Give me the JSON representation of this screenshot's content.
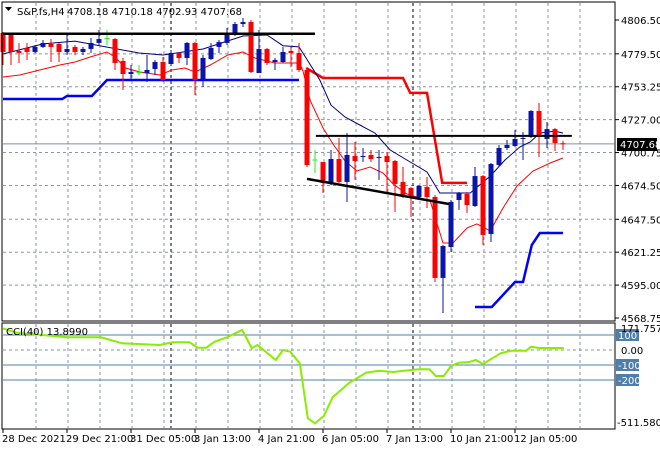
{
  "header": {
    "symbol": "S&P.fs,H4",
    "ohlc": "4708.18 4710.18 4702.93 4707.68"
  },
  "price_axis": {
    "ticks": [
      "4806.50",
      "4779.50",
      "4753.25",
      "4727.00",
      "4700.75",
      "4674.50",
      "4647.50",
      "4621.25",
      "4595.00",
      "4568.75"
    ],
    "tick_values": [
      4806.5,
      4779.5,
      4753.25,
      4727.0,
      4700.75,
      4674.5,
      4647.5,
      4621.25,
      4595.0,
      4568.75
    ],
    "current_price_label": "4707.68",
    "current_price": 4707.68
  },
  "time_axis": {
    "labels": [
      "28 Dec 2021",
      "29 Dec 21:00",
      "31 Dec 05:00",
      "3 Jan 13:00",
      "4 Jan 21:00",
      "6 Jan 05:00",
      "7 Jan 13:00",
      "10 Jan 21:00",
      "12 Jan 05:00"
    ],
    "label_candle_index": [
      0,
      8,
      16,
      24,
      32,
      40,
      48,
      56,
      64
    ]
  },
  "indicator": {
    "label": "CCI(40) 13.8990",
    "max_label": "171.757",
    "min_label": "-511.5801",
    "levels": [
      "100",
      "0.00",
      "-100",
      "-200"
    ],
    "level_values": [
      100,
      0,
      -100,
      -200
    ],
    "range": [
      -511.5801,
      171.757
    ]
  },
  "colors": {
    "bull": "#0a14a8",
    "bear": "#ff0000",
    "doji": "#22ee22",
    "ma_navy": "#000080",
    "ma_red": "#ff0000",
    "channel_blue": "#0000ff",
    "cci": "#88ee00",
    "level": "#4f7fa8"
  },
  "chart_data": {
    "type": "candlestick",
    "title": "S&P.fs,H4",
    "ylim": [
      4568.75,
      4806.5
    ],
    "candles": [
      [
        4796.1,
        4796.9,
        4770.6,
        4781.0
      ],
      [
        4794.5,
        4795.3,
        4770.6,
        4781.0
      ],
      [
        4781.8,
        4788.2,
        4772.2,
        4780.2
      ],
      [
        4784.2,
        4788.2,
        4774.6,
        4781.0
      ],
      [
        4781.0,
        4786.6,
        4780.2,
        4785.0
      ],
      [
        4785.0,
        4790.5,
        4784.2,
        4788.2
      ],
      [
        4787.4,
        4791.3,
        4773.0,
        4785.0
      ],
      [
        4787.4,
        4788.2,
        4773.0,
        4781.0
      ],
      [
        4781.0,
        4796.1,
        4778.6,
        4783.4
      ],
      [
        4785.0,
        4786.6,
        4778.6,
        4781.0
      ],
      [
        4781.0,
        4785.0,
        4778.6,
        4783.4
      ],
      [
        4783.4,
        4792.1,
        4780.2,
        4788.2
      ],
      [
        4788.2,
        4798.5,
        4786.6,
        4791.3
      ],
      [
        4792.1,
        4798.5,
        4786.6,
        4792.1
      ],
      [
        4791.3,
        4792.1,
        4766.6,
        4772.2
      ],
      [
        4773.8,
        4776.2,
        4750.7,
        4763.4
      ],
      [
        4763.4,
        4770.6,
        4758.6,
        4765.0
      ],
      [
        4765.0,
        4770.6,
        4762.6,
        4765.0
      ],
      [
        4764.2,
        4778.6,
        4757.0,
        4766.6
      ],
      [
        4767.4,
        4774.6,
        4762.6,
        4773.0
      ],
      [
        4773.0,
        4777.0,
        4757.0,
        4758.6
      ],
      [
        4771.4,
        4782.6,
        4770.6,
        4780.2
      ],
      [
        4780.2,
        4781.0,
        4772.2,
        4776.2
      ],
      [
        4776.2,
        4788.9,
        4770.6,
        4788.2
      ],
      [
        4788.2,
        4788.9,
        4746.7,
        4758.6
      ],
      [
        4758.6,
        4778.6,
        4753.0,
        4776.2
      ],
      [
        4775.4,
        4788.2,
        4774.6,
        4784.2
      ],
      [
        4785.0,
        4790.5,
        4780.2,
        4788.9
      ],
      [
        4788.2,
        4800.1,
        4786.6,
        4796.1
      ],
      [
        4796.1,
        4804.9,
        4793.7,
        4803.3
      ],
      [
        4803.3,
        4808.1,
        4800.9,
        4804.9
      ],
      [
        4804.9,
        4806.5,
        4764.2,
        4765.0
      ],
      [
        4764.2,
        4798.5,
        4764.2,
        4783.4
      ],
      [
        4783.4,
        4784.2,
        4770.6,
        4772.2
      ],
      [
        4773.0,
        4776.2,
        4766.6,
        4774.6
      ],
      [
        4773.0,
        4785.0,
        4772.2,
        4781.0
      ],
      [
        4781.8,
        4785.0,
        4769.0,
        4780.2
      ],
      [
        4780.2,
        4788.2,
        4765.0,
        4766.6
      ],
      [
        4766.6,
        4768.2,
        4689.2,
        4690.8
      ],
      [
        4694.8,
        4702.8,
        4684.4,
        4695.2
      ],
      [
        4693.2,
        4693.2,
        4668.5,
        4676.5
      ],
      [
        4676.5,
        4702.8,
        4674.9,
        4695.6
      ],
      [
        4695.6,
        4712.4,
        4676.5,
        4677.3
      ],
      [
        4677.3,
        4716.3,
        4661.3,
        4698.8
      ],
      [
        4698.0,
        4709.2,
        4678.9,
        4694.0
      ],
      [
        4697.2,
        4704.4,
        4693.2,
        4698.0
      ],
      [
        4698.8,
        4702.8,
        4693.2,
        4695.6
      ],
      [
        4696.4,
        4702.8,
        4678.9,
        4697.2
      ],
      [
        4698.0,
        4701.2,
        4669.3,
        4693.2
      ],
      [
        4694.0,
        4694.8,
        4653.3,
        4675.7
      ],
      [
        4677.3,
        4689.2,
        4664.5,
        4665.3
      ],
      [
        4672.5,
        4673.3,
        4649.3,
        4665.3
      ],
      [
        4665.3,
        4674.9,
        4664.5,
        4674.1
      ],
      [
        4673.3,
        4681.2,
        4656.5,
        4665.3
      ],
      [
        4665.3,
        4666.9,
        4597.5,
        4600.7
      ],
      [
        4600.7,
        4627.0,
        4572.7,
        4626.2
      ],
      [
        4625.4,
        4662.9,
        4621.4,
        4661.3
      ],
      [
        4662.9,
        4669.3,
        4655.0,
        4668.5
      ],
      [
        4667.7,
        4669.3,
        4652.5,
        4658.9
      ],
      [
        4658.1,
        4689.2,
        4657.3,
        4682.0
      ],
      [
        4682.0,
        4682.8,
        4627.0,
        4635.0
      ],
      [
        4635.8,
        4692.4,
        4629.4,
        4691.6
      ],
      [
        4690.8,
        4706.8,
        4689.2,
        4704.4
      ],
      [
        4704.4,
        4710.8,
        4702.8,
        4706.8
      ],
      [
        4706.0,
        4718.7,
        4705.2,
        4711.6
      ],
      [
        4711.6,
        4717.1,
        4694.8,
        4712.4
      ],
      [
        4713.2,
        4734.7,
        4712.4,
        4733.9
      ],
      [
        4733.9,
        4740.3,
        4697.2,
        4713.2
      ],
      [
        4711.6,
        4725.1,
        4704.4,
        4719.5
      ],
      [
        4719.5,
        4720.3,
        4702.0,
        4708.4
      ],
      [
        4708.18,
        4710.18,
        4702.93,
        4707.68
      ]
    ],
    "lines": {
      "ma_navy": [
        [
          0,
          4779.4
        ],
        [
          5,
          4787.4
        ],
        [
          9,
          4789.7
        ],
        [
          17,
          4780.2
        ],
        [
          20,
          4778.6
        ],
        [
          25,
          4783.4
        ],
        [
          30,
          4793.7
        ],
        [
          33,
          4794.5
        ],
        [
          35,
          4786.0
        ],
        [
          37,
          4785.0
        ],
        [
          38,
          4775.0
        ],
        [
          39.6,
          4758.6
        ],
        [
          41,
          4738.6
        ],
        [
          42.75,
          4729.1
        ],
        [
          44.6,
          4722.7
        ],
        [
          46.5,
          4716.3
        ],
        [
          48.4,
          4702.8
        ],
        [
          50.9,
          4693.2
        ],
        [
          53,
          4685.2
        ],
        [
          54.6,
          4668.5
        ],
        [
          58.4,
          4668.5
        ],
        [
          59.6,
          4674.9
        ],
        [
          60.9,
          4682.0
        ],
        [
          62.75,
          4694.8
        ],
        [
          64.6,
          4705.2
        ],
        [
          65.9,
          4709.2
        ],
        [
          67.1,
          4716.3
        ],
        [
          69,
          4717.9
        ],
        [
          70,
          4716.3
        ]
      ],
      "ma_red": [
        [
          0,
          4761.0
        ],
        [
          2.1,
          4762.6
        ],
        [
          4.6,
          4766.6
        ],
        [
          7.1,
          4770.6
        ],
        [
          9,
          4773.0
        ],
        [
          10.9,
          4777.0
        ],
        [
          13,
          4781.0
        ],
        [
          14,
          4777.0
        ],
        [
          15.3,
          4768.2
        ],
        [
          17.1,
          4765.0
        ],
        [
          19.6,
          4762.6
        ],
        [
          21.1,
          4766.6
        ],
        [
          22.75,
          4768.2
        ],
        [
          24,
          4765.0
        ],
        [
          25.9,
          4770.6
        ],
        [
          28.1,
          4778.6
        ],
        [
          30,
          4781.0
        ],
        [
          31.5,
          4776.2
        ],
        [
          34,
          4772.2
        ],
        [
          37.1,
          4772.2
        ],
        [
          37.5,
          4765.8
        ],
        [
          38.4,
          4742.3
        ],
        [
          40,
          4720.3
        ],
        [
          41.25,
          4707.6
        ],
        [
          42.75,
          4694.0
        ],
        [
          44.25,
          4686.0
        ],
        [
          45.9,
          4689.2
        ],
        [
          47.5,
          4684.4
        ],
        [
          48.75,
          4675.7
        ],
        [
          50.5,
          4667.7
        ],
        [
          53.4,
          4662.1
        ],
        [
          55,
          4628.6
        ],
        [
          56.25,
          4628.6
        ],
        [
          58,
          4640.6
        ],
        [
          59.25,
          4643.8
        ],
        [
          60.9,
          4638.2
        ],
        [
          62.5,
          4656.5
        ],
        [
          64.25,
          4674.1
        ],
        [
          66.25,
          4686.0
        ],
        [
          68.4,
          4692.4
        ],
        [
          70,
          4696.4
        ]
      ],
      "channel_red": [
        [
          37.9,
          4768.2
        ],
        [
          40,
          4760.2
        ],
        [
          50,
          4760.2
        ],
        [
          50.9,
          4748.3
        ],
        [
          53,
          4748.3
        ],
        [
          54.9,
          4676.5
        ],
        [
          58,
          4676.5
        ]
      ],
      "channel_blue_1": [
        [
          0,
          4743.5
        ],
        [
          7.4,
          4743.5
        ],
        [
          8,
          4745.9
        ],
        [
          11.1,
          4745.9
        ],
        [
          13,
          4758.6
        ],
        [
          37,
          4758.6
        ]
      ],
      "channel_blue_2": [
        [
          59,
          4577.5
        ],
        [
          61.1,
          4577.5
        ],
        [
          64,
          4597.5
        ],
        [
          65,
          4597.5
        ],
        [
          66.1,
          4627.0
        ],
        [
          67.1,
          4636.6
        ],
        [
          70,
          4636.6
        ]
      ],
      "trend_top": [
        [
          0,
          4795.5
        ],
        [
          39,
          4795.5
        ]
      ],
      "trend_mid": [
        [
          39.1,
          4714.0
        ],
        [
          71.1,
          4714.0
        ]
      ],
      "trend_slope": [
        [
          38,
          4679.7
        ],
        [
          55.75,
          4659.7
        ]
      ]
    },
    "cci": [
      [
        0,
        144
      ],
      [
        1.7,
        115.5
      ],
      [
        4.9,
        100
      ],
      [
        8,
        84.4
      ],
      [
        12.25,
        84.4
      ],
      [
        14.9,
        44.4
      ],
      [
        19.6,
        33.3
      ],
      [
        21.2,
        51.1
      ],
      [
        23.3,
        51.1
      ],
      [
        24.35,
        15.6
      ],
      [
        25.4,
        15.6
      ],
      [
        26.45,
        55.5
      ],
      [
        28,
        84.4
      ],
      [
        29.9,
        133.3
      ],
      [
        31.1,
        11.1
      ],
      [
        31.8,
        33.3
      ],
      [
        34.1,
        -66.7
      ],
      [
        35,
        0
      ],
      [
        35.9,
        -11.1
      ],
      [
        37.1,
        -88.9
      ],
      [
        38.1,
        -455.5
      ],
      [
        39,
        -488.8
      ],
      [
        40.1,
        -440
      ],
      [
        41.2,
        -315.5
      ],
      [
        43.3,
        -217.8
      ],
      [
        45.4,
        -151
      ],
      [
        47,
        -137.7
      ],
      [
        48.8,
        -146.6
      ],
      [
        50.1,
        -137.7
      ],
      [
        52,
        -128.9
      ],
      [
        53.3,
        -128.9
      ],
      [
        54.1,
        -173.3
      ],
      [
        55.1,
        -173.3
      ],
      [
        56,
        -106.7
      ],
      [
        57,
        -84.4
      ],
      [
        58.3,
        -80
      ],
      [
        59.1,
        -66.7
      ],
      [
        60,
        -93.3
      ],
      [
        62.2,
        -22.2
      ],
      [
        63.5,
        -4.4
      ],
      [
        65.4,
        -4.4
      ],
      [
        66,
        22.2
      ],
      [
        67,
        13.3
      ],
      [
        70.1,
        13.3
      ]
    ],
    "period_separators_candle_index": [
      21,
      51.25
    ]
  }
}
